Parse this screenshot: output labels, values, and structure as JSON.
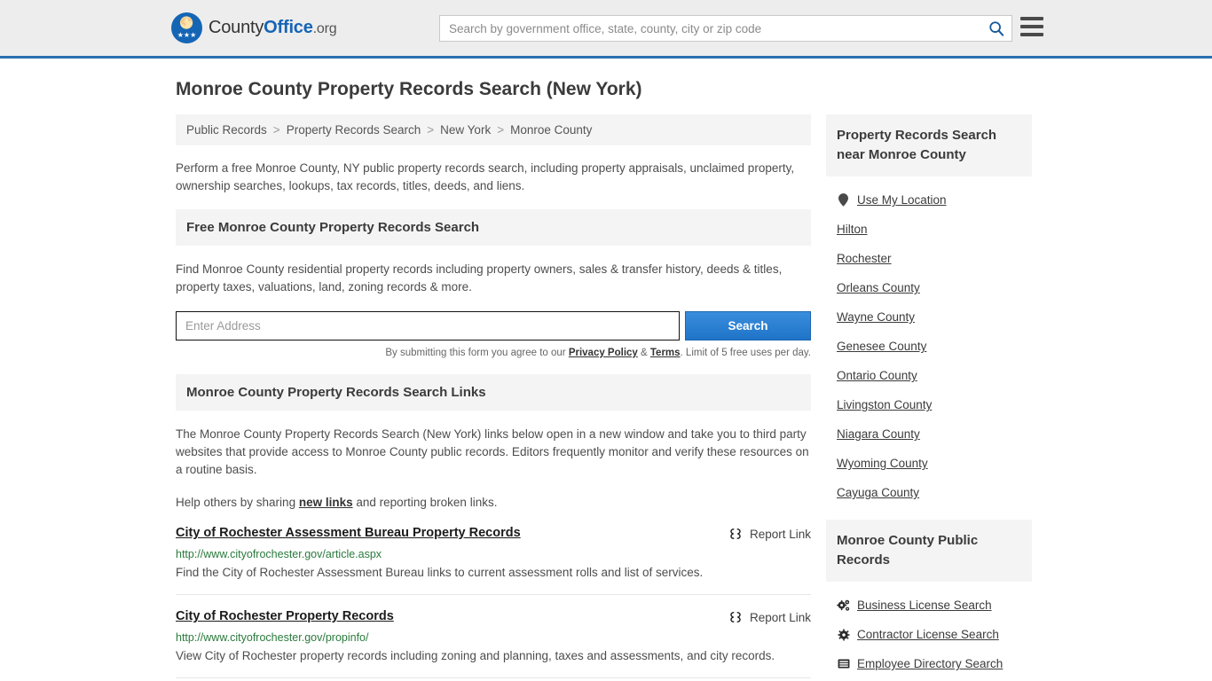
{
  "header": {
    "brand": {
      "county": "County",
      "office": "Office",
      "org": ".org",
      "icon": "eagle-seal-icon"
    },
    "search_placeholder": "Search by government office, state, county, city or zip code",
    "search_value": "",
    "search_icon": "search-icon",
    "menu_icon": "hamburger-menu-icon",
    "accent_color": "#2a6fb0"
  },
  "page_title": "Monroe County Property Records Search (New York)",
  "breadcrumb": [
    "Public Records",
    "Property Records Search",
    "New York",
    "Monroe County"
  ],
  "breadcrumb_separator": ">",
  "lead": "Perform a free Monroe County, NY public property records search, including property appraisals, unclaimed property, ownership searches, lookups, tax records, titles, deeds, and liens.",
  "free_search": {
    "heading": "Free Monroe County Property Records Search",
    "description": "Find Monroe County residential property records including property owners, sales & transfer history, deeds & titles, property taxes, valuations, land, zoning records & more.",
    "address_placeholder": "Enter Address",
    "address_value": "",
    "search_button": "Search",
    "disclaimer_prefix": "By submitting this form you agree to our ",
    "privacy_policy": "Privacy Policy",
    "disclaimer_amp": " & ",
    "terms": "Terms",
    "disclaimer_suffix": ". Limit of 5 free uses per day."
  },
  "links_section": {
    "heading": "Monroe County Property Records Search Links",
    "paragraph": "The Monroe County Property Records Search (New York) links below open in a new window and take you to third party websites that provide access to Monroe County public records. Editors frequently monitor and verify these resources on a routine basis.",
    "help_prefix": "Help others by sharing ",
    "help_link": "new links",
    "help_suffix": " and reporting broken links.",
    "report_label": "Report Link",
    "report_icon": "broken-link-icon"
  },
  "results": [
    {
      "title": "City of Rochester Assessment Bureau Property Records",
      "url": "http://www.cityofrochester.gov/article.aspx",
      "description": "Find the City of Rochester Assessment Bureau links to current assessment rolls and list of services."
    },
    {
      "title": "City of Rochester Property Records",
      "url": "http://www.cityofrochester.gov/propinfo/",
      "description": "View City of Rochester property records including zoning and planning, taxes and assessments, and city records."
    }
  ],
  "sidebar": {
    "nearby": {
      "heading": "Property Records Search near Monroe County",
      "items": [
        {
          "label": "Use My Location",
          "icon": "map-pin-icon"
        },
        {
          "label": "Hilton",
          "icon": null
        },
        {
          "label": "Rochester",
          "icon": null
        },
        {
          "label": "Orleans County",
          "icon": null
        },
        {
          "label": "Wayne County",
          "icon": null
        },
        {
          "label": "Genesee County",
          "icon": null
        },
        {
          "label": "Ontario County",
          "icon": null
        },
        {
          "label": "Livingston County",
          "icon": null
        },
        {
          "label": "Niagara County",
          "icon": null
        },
        {
          "label": "Wyoming County",
          "icon": null
        },
        {
          "label": "Cayuga County",
          "icon": null
        }
      ]
    },
    "public_records": {
      "heading": "Monroe County Public Records",
      "items": [
        {
          "label": "Business License Search",
          "icon": "cogs-icon"
        },
        {
          "label": "Contractor License Search",
          "icon": "gear-icon"
        },
        {
          "label": "Employee Directory Search",
          "icon": "id-card-icon"
        }
      ]
    }
  }
}
